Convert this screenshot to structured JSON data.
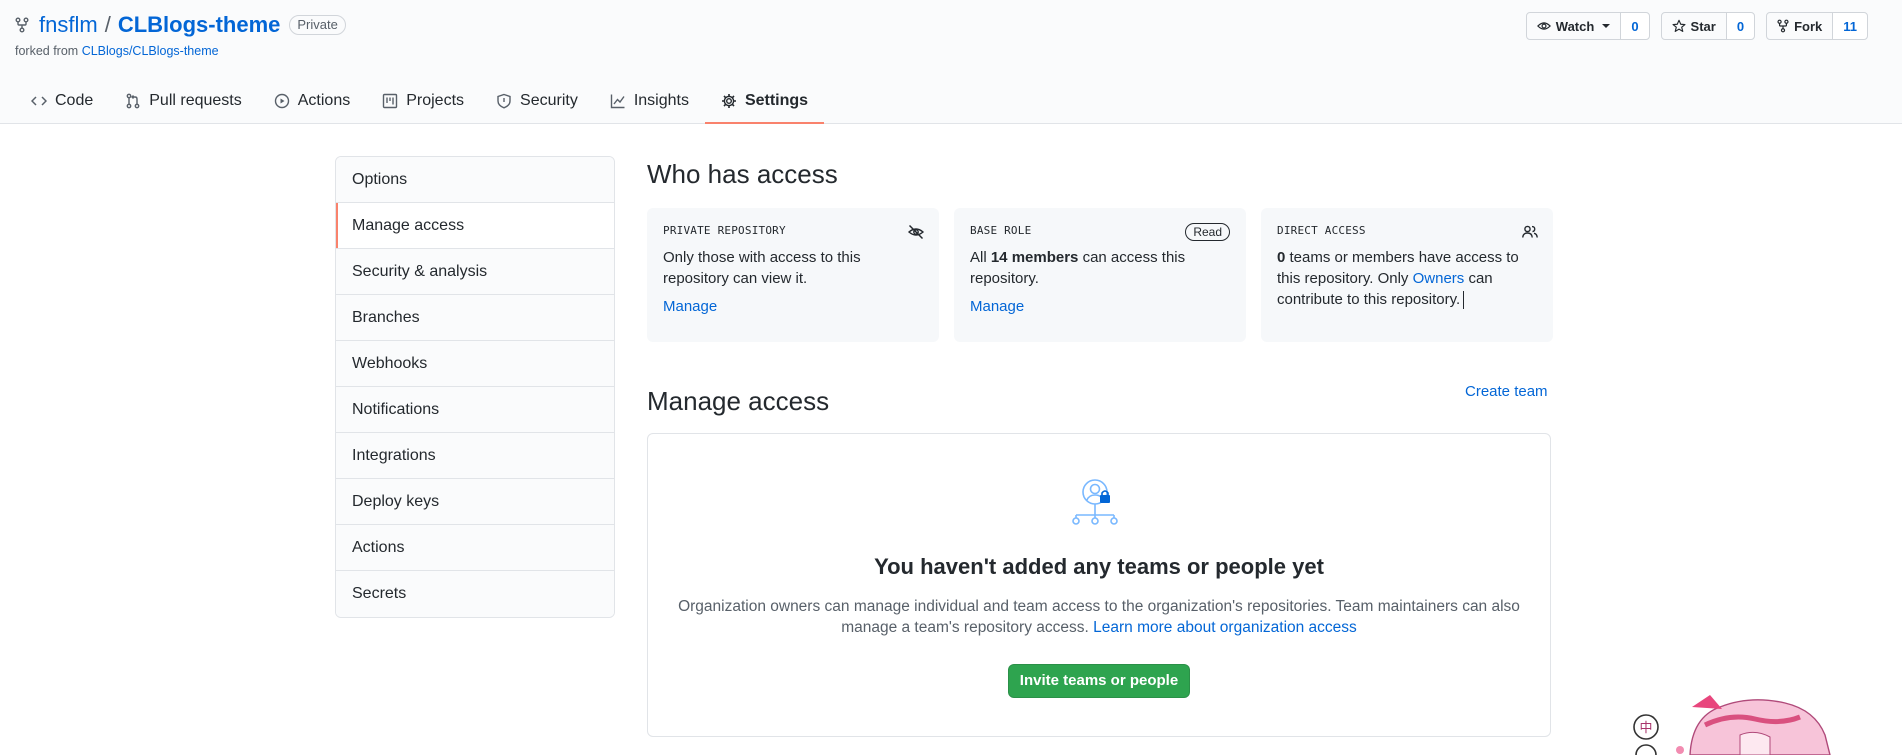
{
  "repo": {
    "owner": "fnsflm",
    "separator": "/",
    "name": "CLBlogs-theme",
    "visibility": "Private",
    "forked_from_prefix": "forked from",
    "forked_from": "CLBlogs/CLBlogs-theme"
  },
  "actions": {
    "watch": {
      "label": "Watch",
      "count": "0"
    },
    "star": {
      "label": "Star",
      "count": "0"
    },
    "fork": {
      "label": "Fork",
      "count": "11"
    }
  },
  "nav": {
    "tabs": [
      {
        "label": "Code",
        "icon": "code-icon"
      },
      {
        "label": "Pull requests",
        "icon": "git-pull-request-icon"
      },
      {
        "label": "Actions",
        "icon": "play-icon"
      },
      {
        "label": "Projects",
        "icon": "project-icon"
      },
      {
        "label": "Security",
        "icon": "shield-icon"
      },
      {
        "label": "Insights",
        "icon": "graph-icon"
      },
      {
        "label": "Settings",
        "icon": "gear-icon",
        "selected": true
      }
    ]
  },
  "sidebar": {
    "items": [
      {
        "label": "Options"
      },
      {
        "label": "Manage access",
        "selected": true
      },
      {
        "label": "Security & analysis"
      },
      {
        "label": "Branches"
      },
      {
        "label": "Webhooks"
      },
      {
        "label": "Notifications"
      },
      {
        "label": "Integrations"
      },
      {
        "label": "Deploy keys"
      },
      {
        "label": "Actions"
      },
      {
        "label": "Secrets"
      }
    ]
  },
  "who_has_access": {
    "title": "Who has access",
    "private": {
      "label": "PRIVATE REPOSITORY",
      "text": "Only those with access to this repository can view it.",
      "link": "Manage"
    },
    "base_role": {
      "label": "BASE ROLE",
      "badge": "Read",
      "text_pre": "All",
      "members": "14 members",
      "text_post": "can access this repository.",
      "link": "Manage"
    },
    "direct": {
      "label": "DIRECT ACCESS",
      "count": "0",
      "text_mid": "teams or members have access to this repository. Only",
      "owners_link": "Owners",
      "text_post": "can contribute to this repository."
    }
  },
  "manage_access": {
    "title": "Manage access",
    "create_team": "Create team",
    "empty_title": "You haven't added any teams or people yet",
    "empty_desc": "Organization owners can manage individual and team access to the organization's repositories. Team maintainers can also manage a team's repository access.",
    "learn_more": "Learn more about organization access",
    "invite_button": "Invite teams or people"
  },
  "colors": {
    "link": "#0366d6",
    "accent_underline": "#f9826c",
    "primary_button": "#2ea44f"
  }
}
